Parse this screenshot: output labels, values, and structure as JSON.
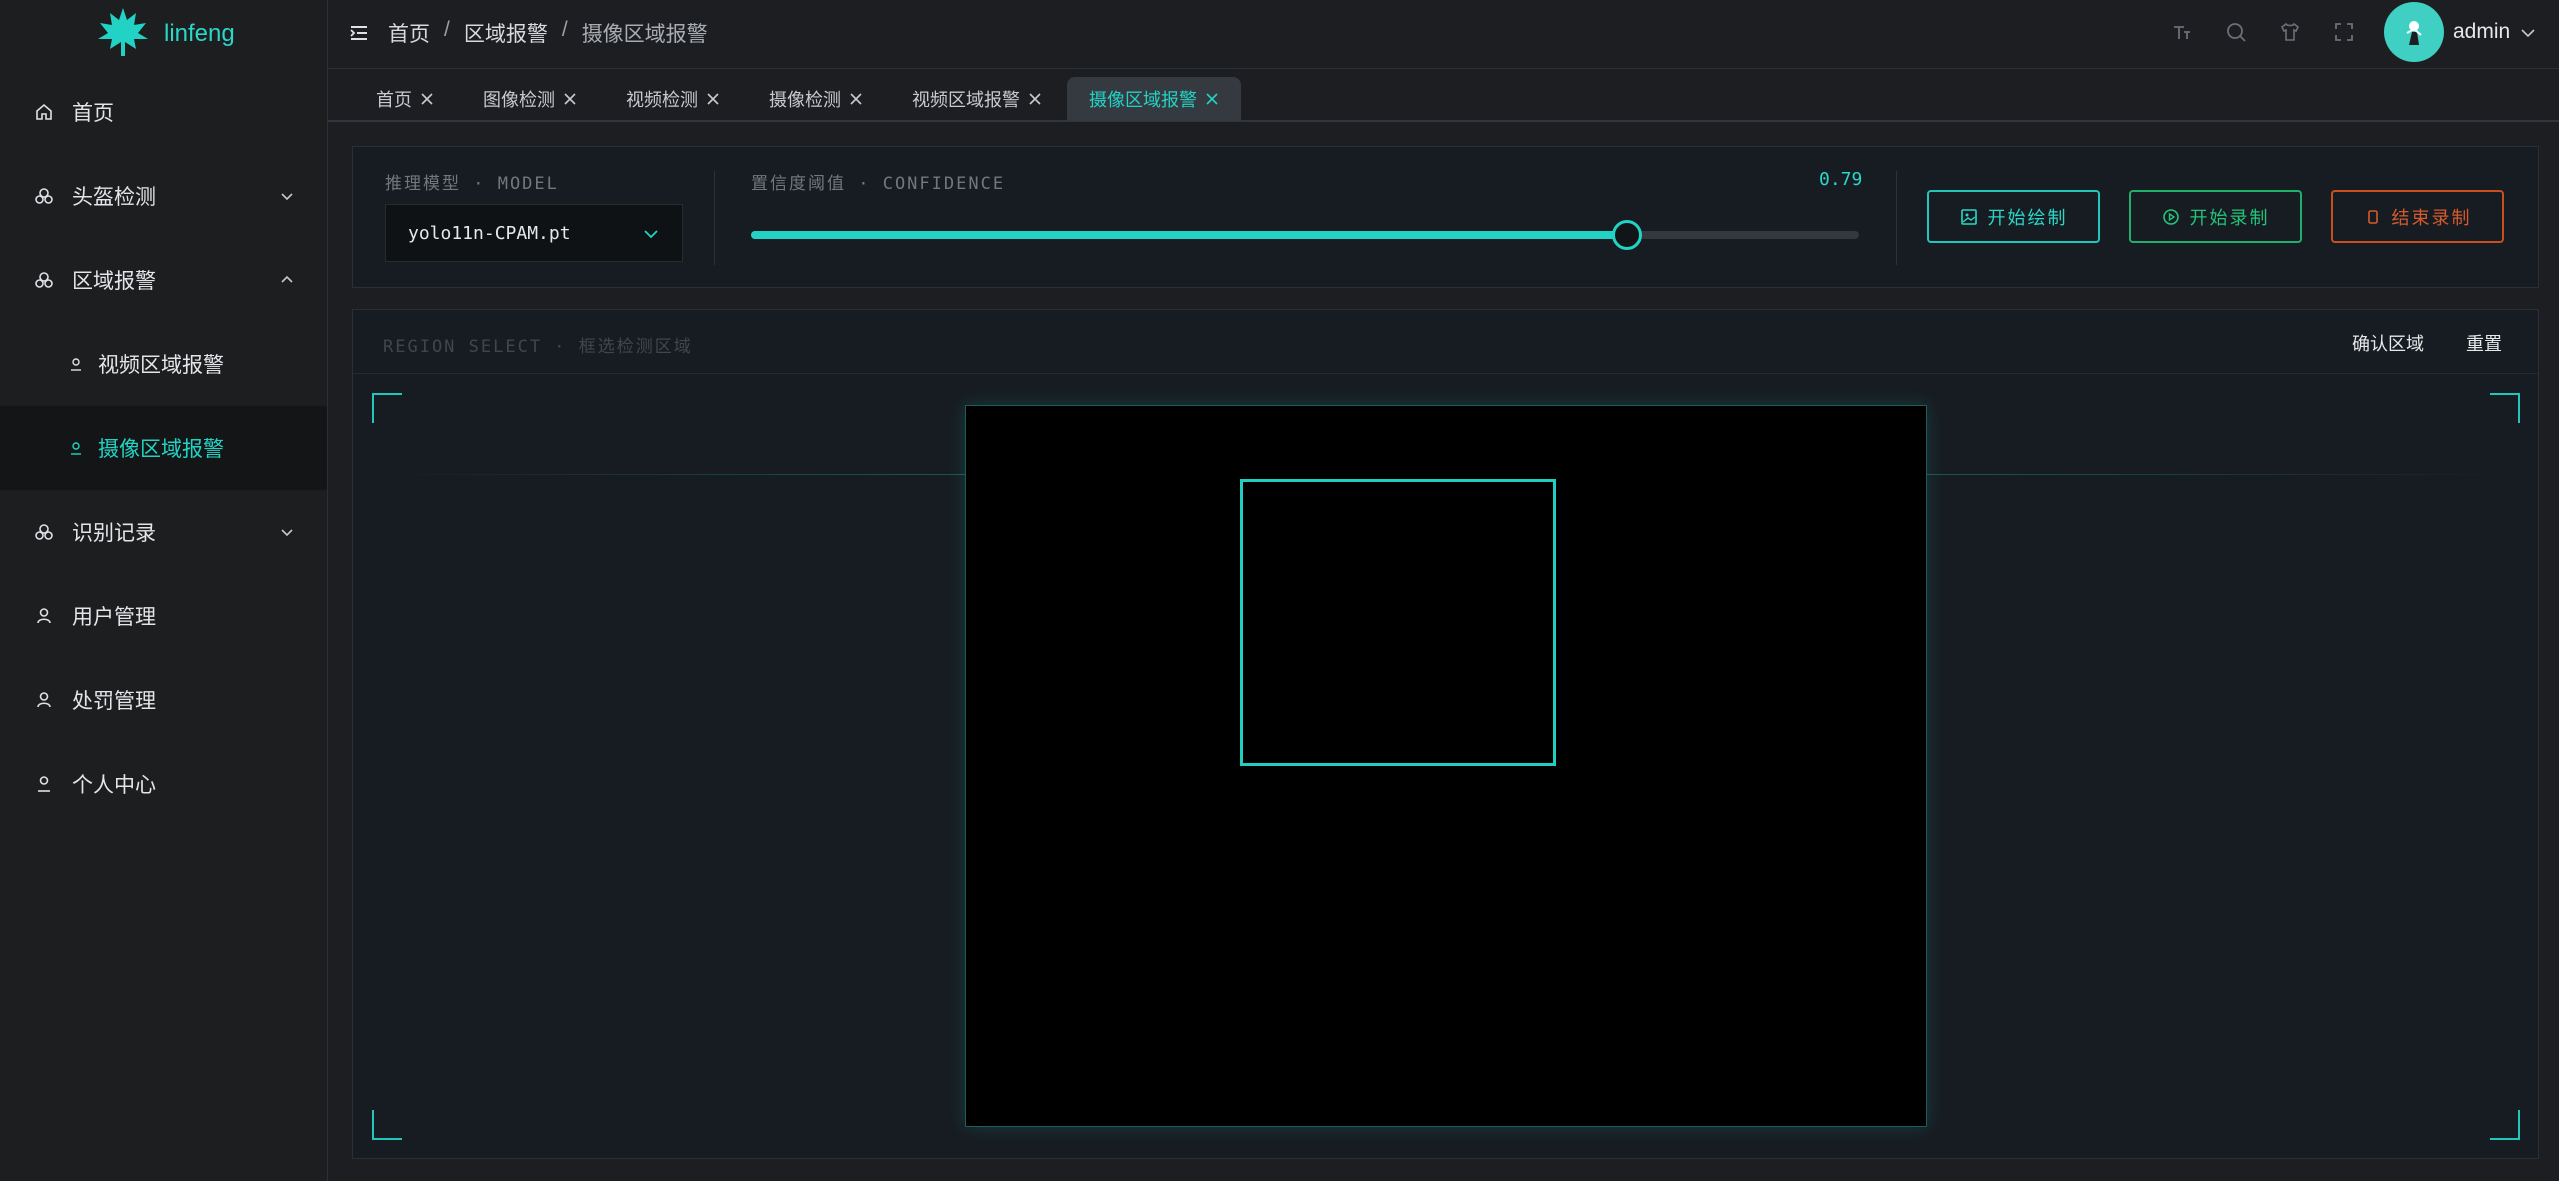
{
  "app": {
    "name": "linfeng"
  },
  "sidebar": {
    "items": [
      {
        "label": "首页",
        "icon": "home-icon"
      },
      {
        "label": "头盔检测",
        "icon": "helmet-icon",
        "expanded": false
      },
      {
        "label": "区域报警",
        "icon": "helmet-icon",
        "expanded": true
      },
      {
        "label": "视频区域报警",
        "icon": "person-icon",
        "sub": true
      },
      {
        "label": "摄像区域报警",
        "icon": "person-icon",
        "sub": true,
        "active": true
      },
      {
        "label": "识别记录",
        "icon": "helmet-icon",
        "expanded": false
      },
      {
        "label": "用户管理",
        "icon": "user-icon"
      },
      {
        "label": "处罚管理",
        "icon": "user-icon"
      },
      {
        "label": "个人中心",
        "icon": "user-icon"
      }
    ]
  },
  "header": {
    "breadcrumb": [
      "首页",
      "区域报警",
      "摄像区域报警"
    ],
    "breadcrumb_sep": "/",
    "username": "admin"
  },
  "tabs": [
    {
      "label": "首页"
    },
    {
      "label": "图像检测"
    },
    {
      "label": "视频检测"
    },
    {
      "label": "摄像检测"
    },
    {
      "label": "视频区域报警"
    },
    {
      "label": "摄像区域报警",
      "active": true
    }
  ],
  "controls": {
    "model_label": "推理模型 · MODEL",
    "model_value": "yolo11n-CPAM.pt",
    "confidence_label": "置信度阈值 · CONFIDENCE",
    "confidence_value": "0.79",
    "confidence_fraction": 0.79,
    "start_draw": "开始绘制",
    "start_record": "开始录制",
    "stop_record": "结束录制"
  },
  "region": {
    "title": "REGION SELECT · 框选检测区域",
    "confirm": "确认区域",
    "reset": "重置"
  },
  "colors": {
    "accent": "#22d3c5",
    "record_green": "#1fb06a",
    "stop_orange": "#c8501f"
  }
}
